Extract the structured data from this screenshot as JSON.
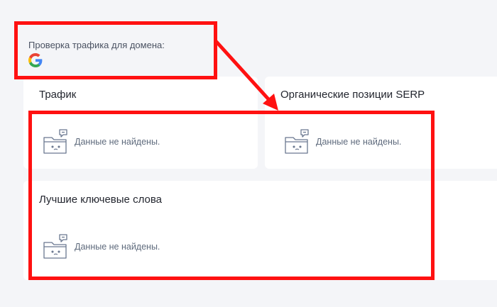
{
  "domain_check": {
    "label": "Проверка трафика для домена:",
    "search_engine_icon": "google-g-icon"
  },
  "cards": {
    "traffic": {
      "title": "Трафик",
      "empty_text": "Данные не найдены."
    },
    "organic_positions": {
      "title": "Органические позиции SERP",
      "empty_text": "Данные не найдены."
    },
    "best_keywords": {
      "title": "Лучшие ключевые слова",
      "empty_text": "Данные не найдены."
    }
  },
  "empty_icon": "empty-folder-chat-icon",
  "colors": {
    "background": "#f4f5f8",
    "card": "#ffffff",
    "highlight": "#ff1111",
    "muted_text": "#5f6b7d"
  }
}
